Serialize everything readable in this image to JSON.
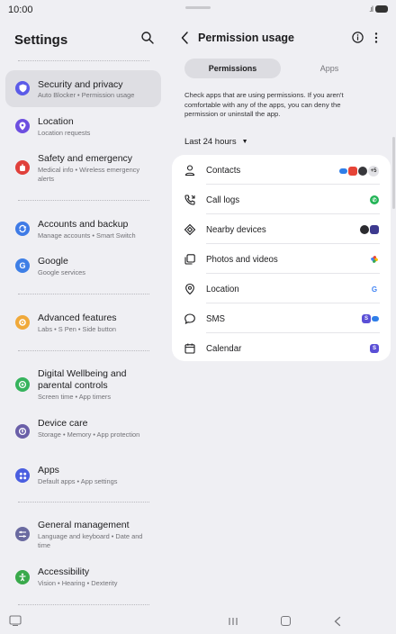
{
  "status": {
    "time": "10:00"
  },
  "settings": {
    "title": "Settings",
    "items": [
      {
        "id": "security",
        "title": "Security and privacy",
        "subtitle": "Auto Blocker • Permission usage",
        "icon": "shield-icon",
        "color": "#5b5be8"
      },
      {
        "id": "location",
        "title": "Location",
        "subtitle": "Location requests",
        "icon": "location-pin-icon",
        "color": "#6d4fe0"
      },
      {
        "id": "safety",
        "title": "Safety and emergency",
        "subtitle": "Medical info • Wireless emergency alerts",
        "icon": "alert-icon",
        "color": "#e0403b"
      },
      {
        "id": "accounts",
        "title": "Accounts and backup",
        "subtitle": "Manage accounts • Smart Switch",
        "icon": "sync-icon",
        "color": "#3f7be6"
      },
      {
        "id": "google",
        "title": "Google",
        "subtitle": "Google services",
        "icon": "google-icon",
        "color": "#3e7fe6"
      },
      {
        "id": "advanced",
        "title": "Advanced features",
        "subtitle": "Labs • S Pen • Side button",
        "icon": "gear-plus-icon",
        "color": "#f0a93a"
      },
      {
        "id": "wellbeing",
        "title": "Digital Wellbeing and parental controls",
        "subtitle": "Screen time • App timers",
        "icon": "wellbeing-icon",
        "color": "#36b35d"
      },
      {
        "id": "device",
        "title": "Device care",
        "subtitle": "Storage • Memory • App protection",
        "icon": "device-care-icon",
        "color": "#6a5fa8"
      },
      {
        "id": "apps",
        "title": "Apps",
        "subtitle": "Default apps • App settings",
        "icon": "apps-grid-icon",
        "color": "#4a5ee0"
      },
      {
        "id": "general",
        "title": "General management",
        "subtitle": "Language and keyboard • Date and time",
        "icon": "sliders-icon",
        "color": "#6a6aa0"
      },
      {
        "id": "accessibility",
        "title": "Accessibility",
        "subtitle": "Vision • Hearing • Dexterity",
        "icon": "accessibility-icon",
        "color": "#39a94b"
      }
    ]
  },
  "permission": {
    "title": "Permission usage",
    "tabs": [
      "Permissions",
      "Apps"
    ],
    "description": "Check apps that are using permissions. If you aren't comfortable with any of the apps, you can deny the permission or uninstall the app.",
    "range": "Last 24 hours",
    "rows": [
      {
        "label": "Contacts",
        "icon": "person-icon",
        "extra": "+5"
      },
      {
        "label": "Call logs",
        "icon": "call-log-icon"
      },
      {
        "label": "Nearby devices",
        "icon": "nearby-icon"
      },
      {
        "label": "Photos and videos",
        "icon": "photos-icon"
      },
      {
        "label": "Location",
        "icon": "location-icon"
      },
      {
        "label": "SMS",
        "icon": "sms-icon"
      },
      {
        "label": "Calendar",
        "icon": "calendar-icon"
      }
    ]
  }
}
